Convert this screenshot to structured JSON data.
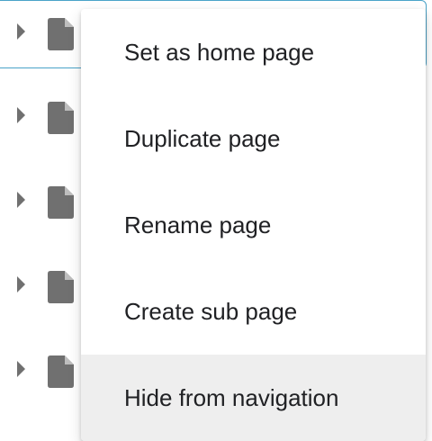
{
  "menu": {
    "items": [
      {
        "label": "Set as home page"
      },
      {
        "label": "Duplicate page"
      },
      {
        "label": "Rename page"
      },
      {
        "label": "Create sub page"
      },
      {
        "label": "Hide from navigation",
        "hovered": true
      }
    ]
  },
  "tree": {
    "rows": [
      {
        "icon": "page-icon",
        "expand_icon": "caret-right-icon",
        "selected": true
      },
      {
        "icon": "page-icon",
        "expand_icon": "caret-right-icon"
      },
      {
        "icon": "page-icon",
        "expand_icon": "caret-right-icon"
      },
      {
        "icon": "page-icon",
        "expand_icon": "caret-right-icon"
      },
      {
        "icon": "page-icon",
        "expand_icon": "caret-right-icon"
      }
    ]
  },
  "colors": {
    "icon": "#707070",
    "selection_border": "#4aa3c8",
    "hover_background": "#eeeeee",
    "text": "#202124"
  }
}
